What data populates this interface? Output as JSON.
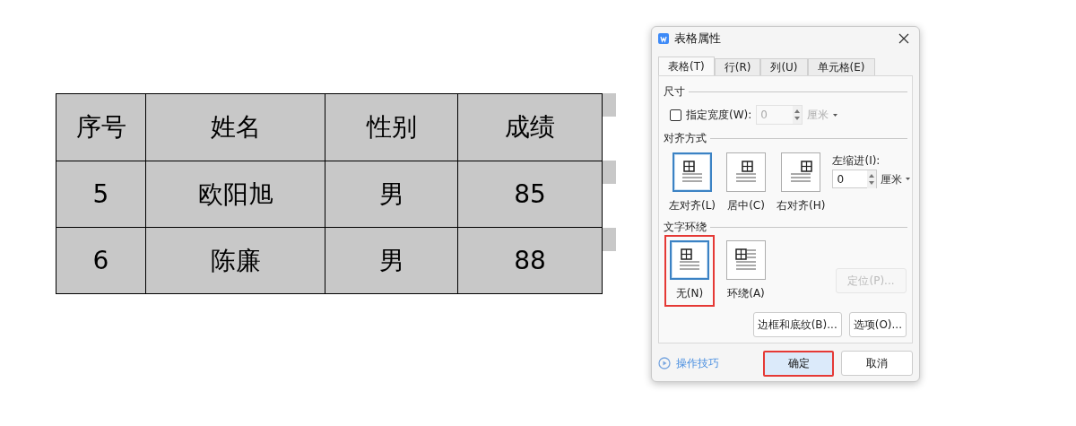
{
  "table": {
    "columns": [
      "序号",
      "姓名",
      "性别",
      "成绩"
    ],
    "rows": [
      [
        "5",
        "欧阳旭",
        "男",
        "85"
      ],
      [
        "6",
        "陈廉",
        "男",
        "88"
      ]
    ]
  },
  "dialog": {
    "title": "表格属性",
    "tabs": [
      {
        "label": "表格(T)",
        "selected": true
      },
      {
        "label": "行(R)",
        "selected": false
      },
      {
        "label": "列(U)",
        "selected": false
      },
      {
        "label": "单元格(E)",
        "selected": false
      }
    ],
    "size_section": {
      "heading": "尺寸",
      "width_checkbox": {
        "label": "指定宽度(W):",
        "checked": false
      },
      "width_field": {
        "value": "0",
        "disabled": true
      },
      "unit": "厘米"
    },
    "alignment_section": {
      "heading": "对齐方式",
      "options": [
        {
          "label": "左对齐(L)",
          "kind": "left",
          "selected": true
        },
        {
          "label": "居中(C)",
          "kind": "center",
          "selected": false
        },
        {
          "label": "右对齐(H)",
          "kind": "right",
          "selected": false
        }
      ],
      "indent_label": "左缩进(I):",
      "indent_value": "0",
      "indent_unit": "厘米"
    },
    "wrap_section": {
      "heading": "文字环绕",
      "options": [
        {
          "label": "无(N)",
          "kind": "none",
          "selected": true,
          "highlighted": true
        },
        {
          "label": "环绕(A)",
          "kind": "around",
          "selected": false
        }
      ],
      "position_button": {
        "label": "定位(P)...",
        "disabled": true
      }
    },
    "buttons": [
      "边框和底纹(B)...",
      "选项(O)..."
    ],
    "tips_link": "操作技巧",
    "ok_button": {
      "label": "确定",
      "highlighted": true
    },
    "cancel_button": "取消"
  }
}
